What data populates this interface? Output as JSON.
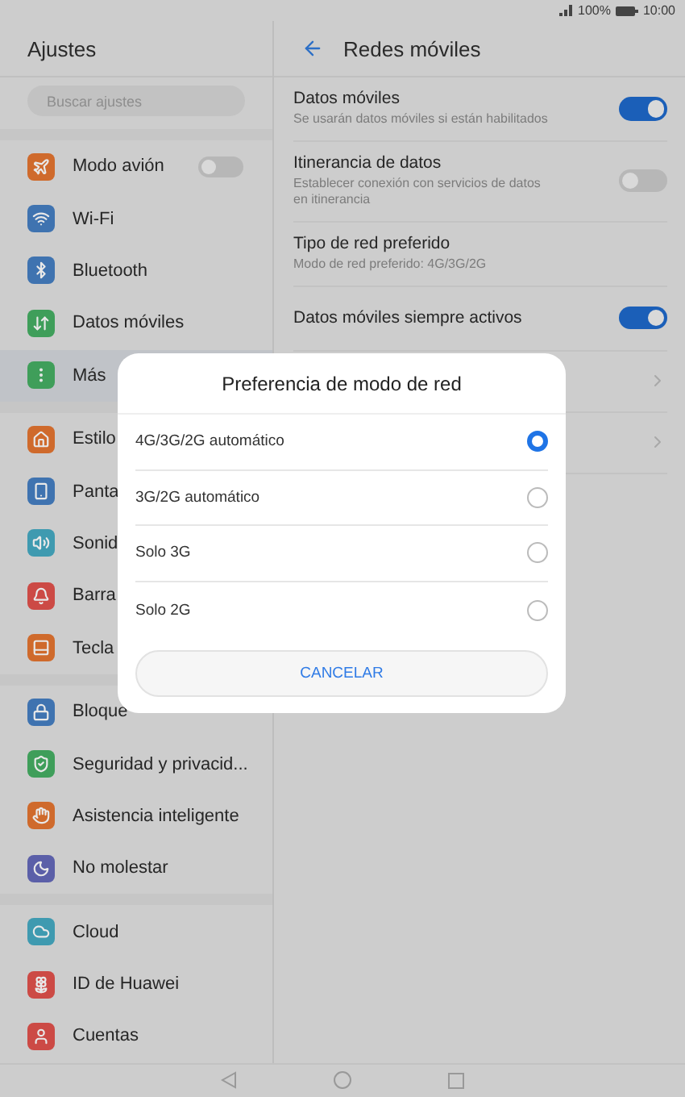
{
  "status_bar": {
    "battery": "100%",
    "time": "10:00"
  },
  "sidebar": {
    "title": "Ajustes",
    "search": {
      "placeholder": "Buscar ajustes"
    },
    "groups": [
      [
        {
          "label": "Modo avión",
          "selected": false,
          "toggle": {
            "on": false
          }
        },
        {
          "label": "Wi-Fi",
          "selected": false
        },
        {
          "label": "Bluetooth",
          "selected": false
        },
        {
          "label": "Datos móviles",
          "selected": false
        },
        {
          "label": "Más",
          "selected": true
        }
      ],
      [
        {
          "label": "Estilo",
          "selected": false
        },
        {
          "label": "Panta",
          "selected": false
        },
        {
          "label": "Sonid",
          "selected": false
        },
        {
          "label": "Barra",
          "selected": false
        },
        {
          "label": "Tecla",
          "selected": false
        }
      ],
      [
        {
          "label": "Bloque",
          "selected": false
        },
        {
          "label": "Seguridad y privacid...",
          "selected": false
        },
        {
          "label": "Asistencia inteligente",
          "selected": false
        },
        {
          "label": "No molestar",
          "selected": false
        }
      ],
      [
        {
          "label": "Cloud",
          "selected": false
        },
        {
          "label": "ID de Huawei",
          "selected": false
        },
        {
          "label": "Cuentas",
          "selected": false
        }
      ]
    ]
  },
  "panel": {
    "title": "Redes móviles",
    "rows": [
      {
        "kind": "toggle",
        "title": "Datos móviles",
        "subtitle": "Se usarán datos móviles si están habilitados",
        "on": true
      },
      {
        "kind": "toggle",
        "title": "Itinerancia de datos",
        "subtitle": "Establecer conexión con servicios de datos en itinerancia",
        "on": false
      },
      {
        "kind": "text",
        "title": "Tipo de red preferido",
        "subtitle": "Modo de red preferido: 4G/3G/2G"
      },
      {
        "kind": "toggle",
        "title": "Datos móviles siempre activos",
        "on": true
      },
      {
        "kind": "chevron"
      },
      {
        "kind": "chevron"
      }
    ]
  },
  "dialog": {
    "title": "Preferencia de modo de red",
    "options": [
      {
        "label": "4G/3G/2G automático",
        "selected": true
      },
      {
        "label": "3G/2G automático",
        "selected": false
      },
      {
        "label": "Solo 3G",
        "selected": false
      },
      {
        "label": "Solo 2G",
        "selected": false
      }
    ],
    "cancel": "CANCELAR"
  }
}
